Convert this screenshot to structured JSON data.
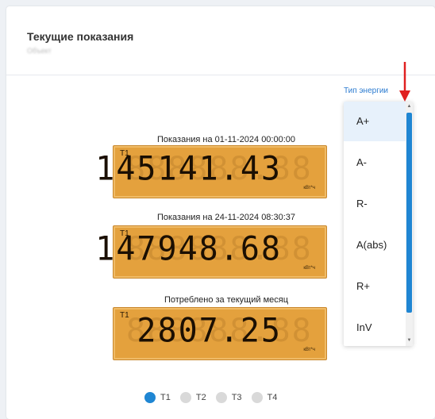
{
  "card": {
    "title": "Текущие показания",
    "subtitle": "Объект"
  },
  "energy_type": {
    "label": "Тип энергии",
    "options": [
      "A+",
      "A-",
      "R-",
      "A(abs)",
      "R+",
      "InV"
    ],
    "selected_index": 0
  },
  "readings": [
    {
      "label": "Показания на 01-11-2024 00:00:00",
      "tariff": "T1",
      "value": "145141.43",
      "unit": "кВт*ч"
    },
    {
      "label": "Показания на 24-11-2024 08:30:37",
      "tariff": "T1",
      "value": "147948.68",
      "unit": "кВт*ч"
    },
    {
      "label": "Потреблено за текущий месяц",
      "tariff": "T1",
      "value": "2807.25",
      "unit": "кВт*ч"
    }
  ],
  "tariff_tabs": [
    {
      "label": "T1",
      "active": true
    },
    {
      "label": "T2",
      "active": false
    },
    {
      "label": "T3",
      "active": false
    },
    {
      "label": "T4",
      "active": false
    }
  ],
  "colors": {
    "accent": "#1f86d3",
    "lcd_bg": "#e4a13d",
    "arrow": "#e02020"
  },
  "icons": [
    "arrow-down-icon",
    "scroll-up-icon",
    "scroll-down-icon"
  ]
}
